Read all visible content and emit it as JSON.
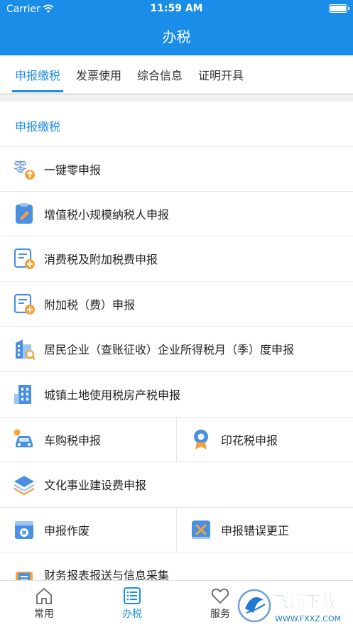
{
  "status": {
    "carrier": "Carrier",
    "time": "11:59 AM"
  },
  "header": {
    "title": "办税"
  },
  "tabs": [
    {
      "label": "申报缴税",
      "active": true
    },
    {
      "label": "发票使用",
      "active": false
    },
    {
      "label": "综合信息",
      "active": false
    },
    {
      "label": "证明开具",
      "active": false
    }
  ],
  "section": {
    "title": "申报缴税"
  },
  "items": [
    {
      "label": "一键零申报",
      "icon": "zero-declare-icon"
    },
    {
      "label": "增值税小规模纳税人申报",
      "icon": "vat-clipboard-icon"
    },
    {
      "label": "消费税及附加税费申报",
      "icon": "form-plus-icon"
    },
    {
      "label": "附加税（费）申报",
      "icon": "form-plus-icon"
    },
    {
      "label": "居民企业（查账征收）企业所得税月（季）度申报",
      "icon": "building-search-icon"
    },
    {
      "label": "城镇土地使用税房产税申报",
      "icon": "building-icon"
    },
    {
      "label": "车购税申报",
      "icon": "car-icon"
    },
    {
      "label": "印花税申报",
      "icon": "stamp-badge-icon"
    },
    {
      "label": "文化事业建设费申报",
      "icon": "layers-icon"
    },
    {
      "label": "申报作废",
      "icon": "void-window-icon"
    },
    {
      "label": "申报错误更正",
      "icon": "correction-icon"
    },
    {
      "label": "财务报表报送与信息采集",
      "icon": "report-icon"
    }
  ],
  "bottom_nav": [
    {
      "label": "常用",
      "icon": "home-icon",
      "active": false
    },
    {
      "label": "办税",
      "icon": "list-icon",
      "active": true
    },
    {
      "label": "服务",
      "icon": "heart-icon",
      "active": false
    }
  ],
  "watermark": {
    "text": "飞翔下载",
    "url": "WWW.FXXZ.COM"
  },
  "colors": {
    "primary": "#1a8de9",
    "divider": "#e8e8e8",
    "gap": "#f1f1f1"
  }
}
